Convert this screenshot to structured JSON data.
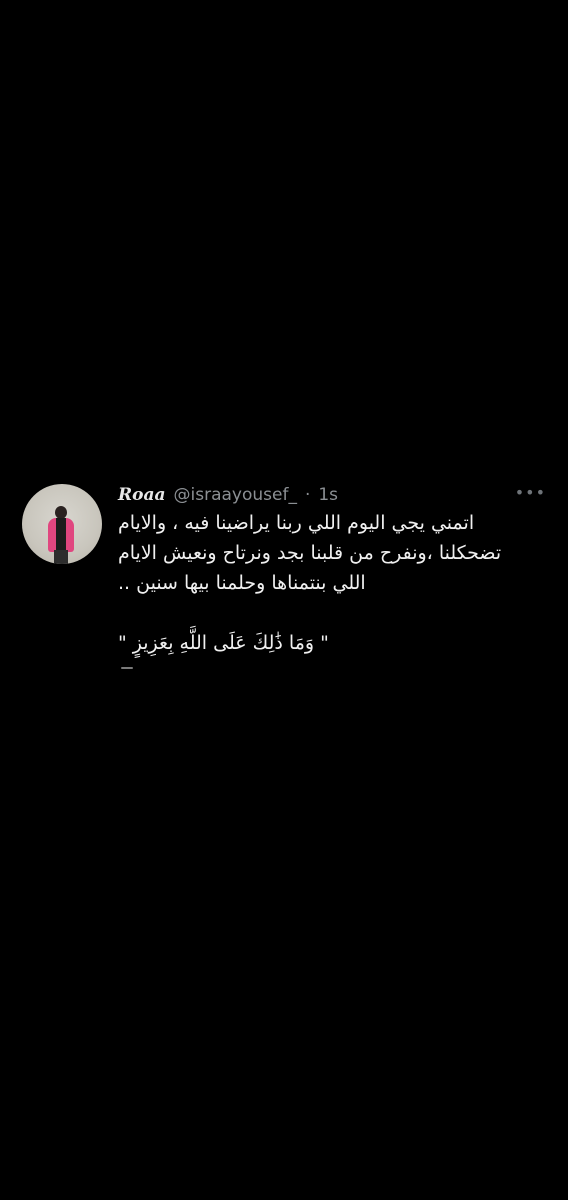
{
  "tweet": {
    "display_name": "Roaa",
    "handle": "@israayousef_",
    "separator": "·",
    "time": "1s",
    "more_icon": "more-horizontal-icon",
    "body_lines": [
      "اتمني يجي اليوم اللي ربنا يراضينا فيه ، والايام",
      "تضحكلنا ،ونفرح من قلبنا بجد ونرتاح ونعيش الايام",
      "اللي بنتمناها وحلمنا بيها سنين .."
    ],
    "quote_line": "\" وَمَا ذَٰلِكَ عَلَى اللَّهِ بِعَزِيزٍ \""
  },
  "colors": {
    "background": "#000000",
    "text_primary": "#f0f0f0",
    "text_secondary": "#8b8f93"
  }
}
